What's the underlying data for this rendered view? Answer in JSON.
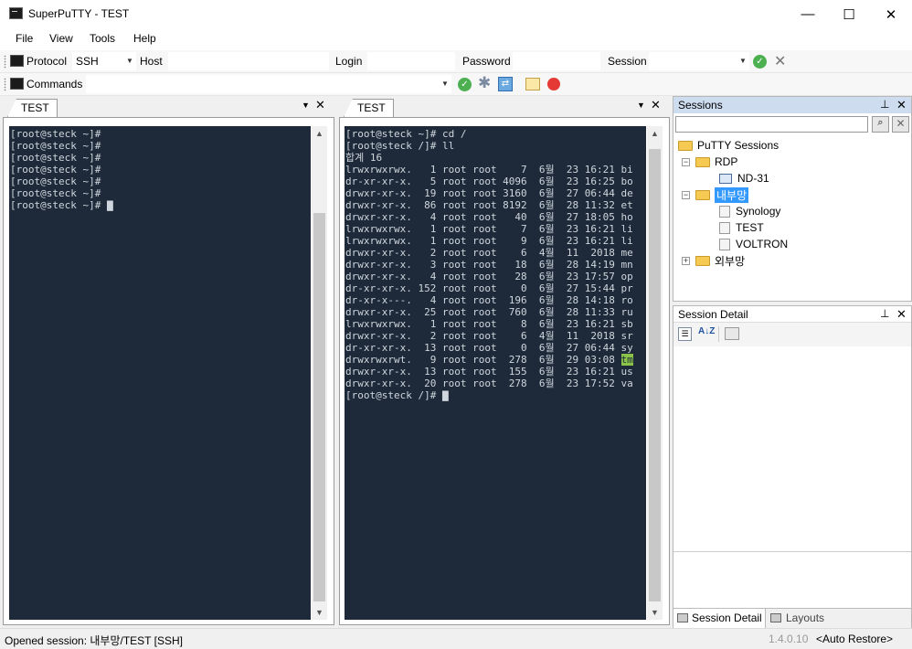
{
  "window": {
    "title": "SuperPuTTY - TEST",
    "minimize_glyph": "—",
    "maximize_glyph": "☐",
    "close_glyph": "✕"
  },
  "menu": [
    "File",
    "View",
    "Tools",
    "Help"
  ],
  "connection_bar": {
    "protocol_label": "Protocol",
    "protocol_value": "SSH",
    "host_label": "Host",
    "host_value": "",
    "login_label": "Login",
    "login_value": "",
    "password_label": "Password",
    "password_value": "",
    "session_label": "Session",
    "session_value": ""
  },
  "commands_bar": {
    "label": "Commands",
    "value": ""
  },
  "panes": [
    {
      "tab": "TEST",
      "lines": [
        "[root@steck ~]#",
        "[root@steck ~]#",
        "[root@steck ~]#",
        "[root@steck ~]#",
        "[root@steck ~]#",
        "[root@steck ~]#",
        "[root@steck ~]# ▇"
      ]
    },
    {
      "tab": "TEST",
      "lines": [
        "[root@steck ~]# cd /",
        "[root@steck /]# ll",
        "합계 16",
        "lrwxrwxrwx.   1 root root    7  6월  23 16:21 bi",
        "dr-xr-xr-x.   5 root root 4096  6월  23 16:25 bo",
        "drwxr-xr-x.  19 root root 3160  6월  27 06:44 de",
        "drwxr-xr-x.  86 root root 8192  6월  28 11:32 et",
        "drwxr-xr-x.   4 root root   40  6월  27 18:05 ho",
        "lrwxrwxrwx.   1 root root    7  6월  23 16:21 li",
        "lrwxrwxrwx.   1 root root    9  6월  23 16:21 li",
        "drwxr-xr-x.   2 root root    6  4월  11  2018 me",
        "drwxr-xr-x.   3 root root   18  6월  28 14:19 mn",
        "drwxr-xr-x.   4 root root   28  6월  23 17:57 op",
        "dr-xr-xr-x. 152 root root    0  6월  27 15:44 pr",
        "dr-xr-x---.   4 root root  196  6월  28 14:18 ro",
        "drwxr-xr-x.  25 root root  760  6월  28 11:33 ru",
        "lrwxrwxrwx.   1 root root    8  6월  23 16:21 sb",
        "drwxr-xr-x.   2 root root    6  4월  11  2018 sr",
        "dr-xr-xr-x.  13 root root    0  6월  27 06:44 sy",
        "drwxrwxrwt.   9 root root  278  6월  29 03:08 ",
        "drwxr-xr-x.  13 root root  155  6월  23 16:21 us",
        "drwxr-xr-x.  20 root root  278  6월  23 17:52 va",
        "[root@steck /]# ▇"
      ],
      "highlight_text": "tm",
      "highlight_line": 19
    }
  ],
  "sessions_panel": {
    "title": "Sessions",
    "search_value": "",
    "tree": [
      {
        "label": "PuTTY Sessions",
        "kind": "folder",
        "level": 0
      },
      {
        "label": "RDP",
        "kind": "folder",
        "level": 1,
        "expander": "−"
      },
      {
        "label": "ND-31",
        "kind": "pc",
        "level": 2
      },
      {
        "label": "내부망",
        "kind": "folder",
        "level": 1,
        "expander": "−",
        "selected": true
      },
      {
        "label": "Synology",
        "kind": "doc",
        "level": 2
      },
      {
        "label": "TEST",
        "kind": "doc",
        "level": 2
      },
      {
        "label": "VOLTRON",
        "kind": "doc",
        "level": 2
      },
      {
        "label": "외부망",
        "kind": "folder",
        "level": 1,
        "expander": "+"
      }
    ]
  },
  "detail_panel": {
    "title": "Session Detail",
    "sort_glyph": "A↓Z"
  },
  "bottom_tabs": [
    "Session Detail",
    "Layouts"
  ],
  "status": {
    "text": "Opened session: 내부망/TEST [SSH]",
    "version": "1.4.0.10",
    "mode": "<Auto Restore>"
  },
  "colors": {
    "terminal_bg": "#1e2a3a",
    "panel_header": "#cddcee",
    "selection": "#3399ff",
    "ok_green": "#4caf50",
    "record_red": "#e53935"
  }
}
